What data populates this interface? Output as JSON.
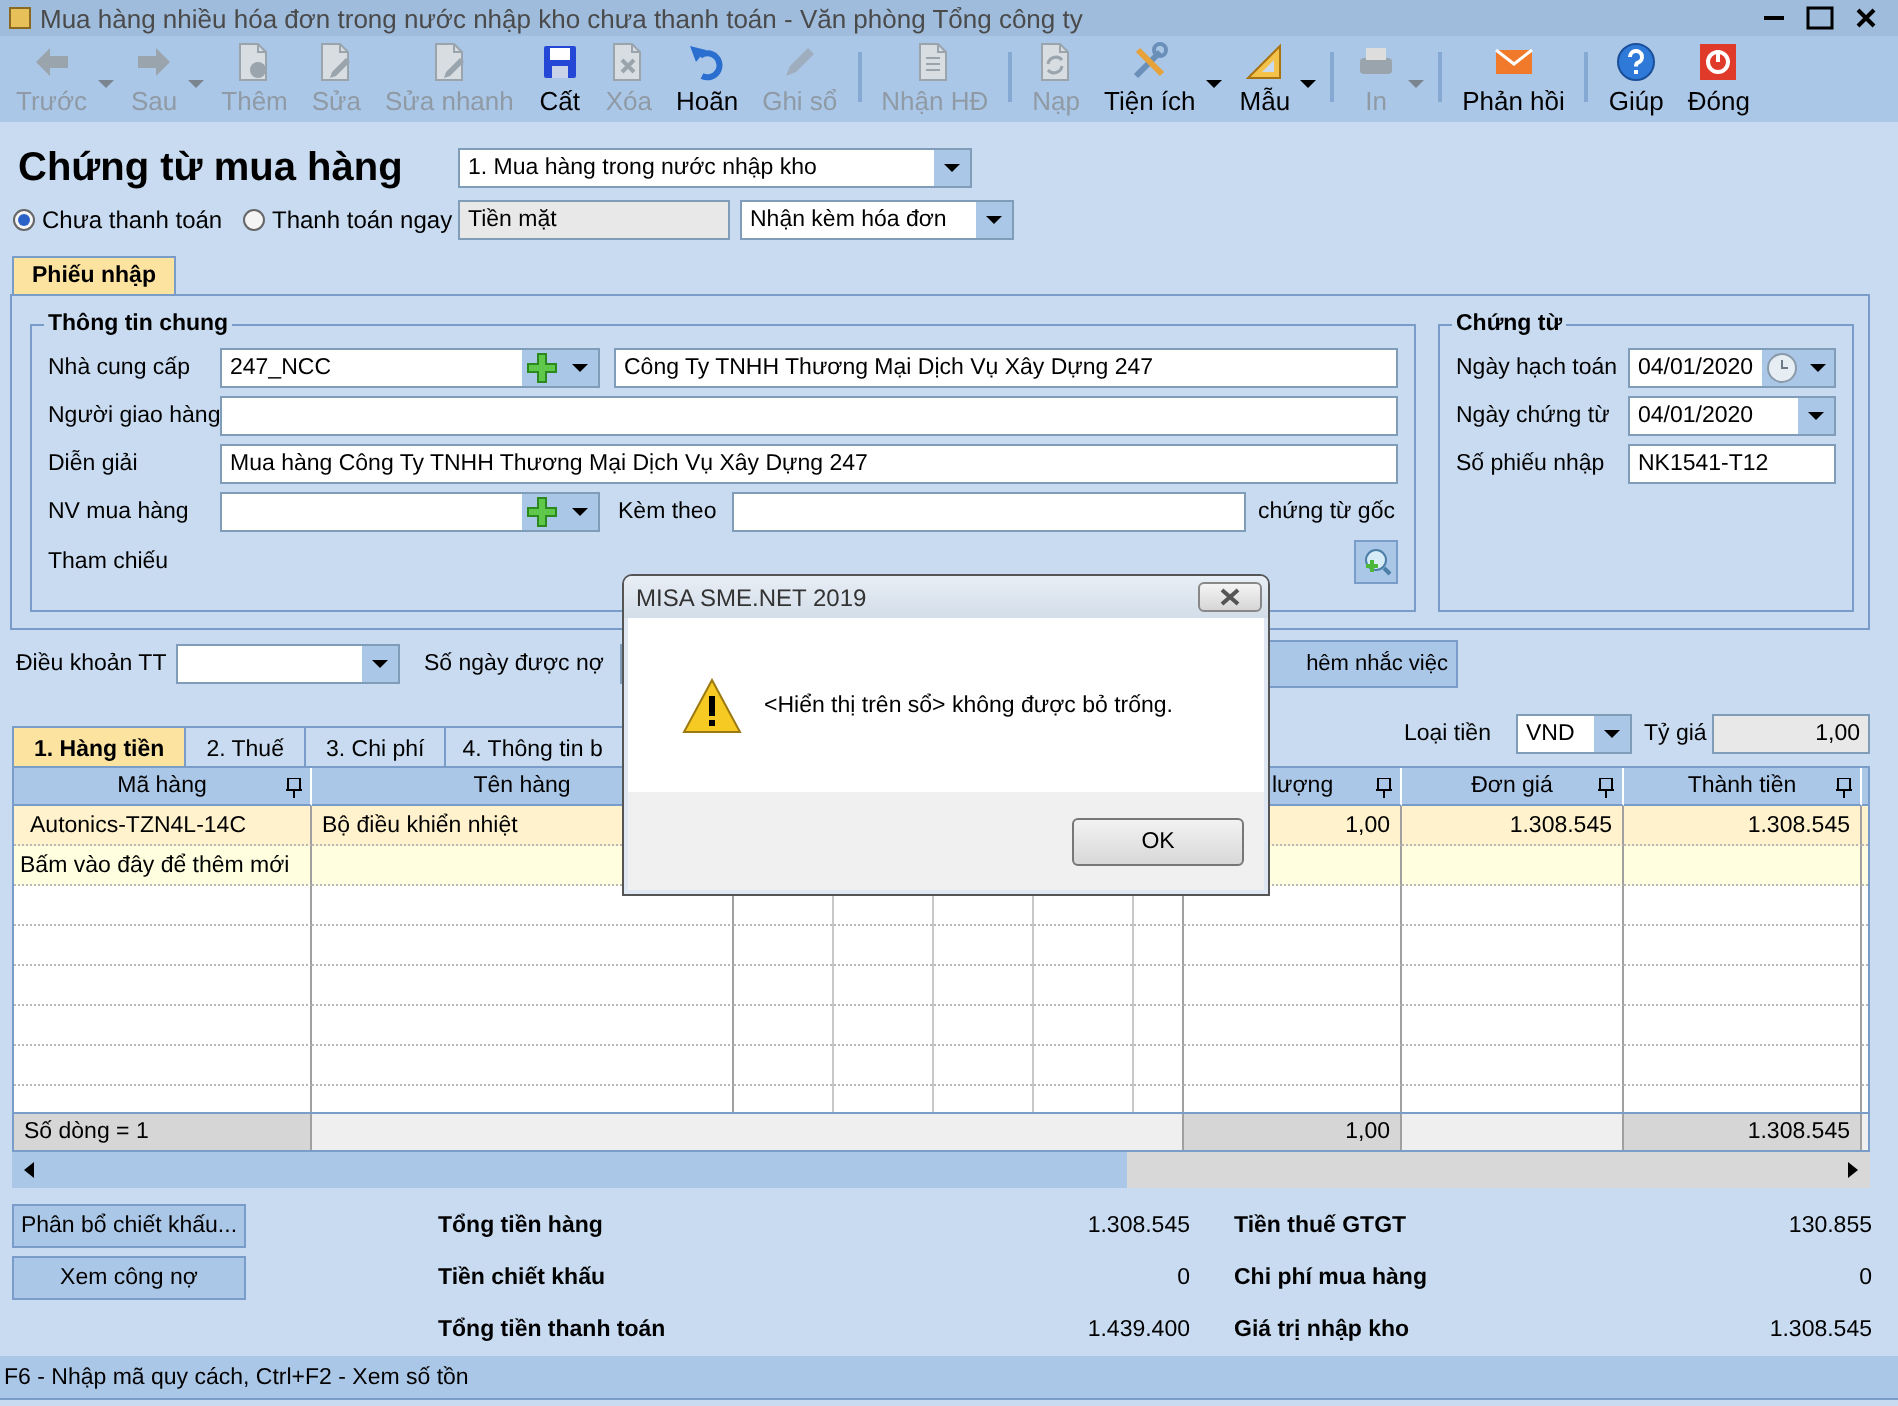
{
  "window": {
    "title": "Mua hàng nhiều hóa đơn trong nước nhập kho chưa thanh toán - Văn phòng Tổng công ty"
  },
  "toolbar": [
    {
      "label": "Trước",
      "kind": "back",
      "disabled": true,
      "dropdown": true,
      "separator_after": false
    },
    {
      "label": "Sau",
      "kind": "forward",
      "disabled": true,
      "dropdown": true,
      "separator_after": false
    },
    {
      "label": "Thêm",
      "kind": "add",
      "disabled": true,
      "dropdown": false,
      "separator_after": false
    },
    {
      "label": "Sửa",
      "kind": "edit",
      "disabled": true,
      "dropdown": false,
      "separator_after": false
    },
    {
      "label": "Sửa nhanh",
      "kind": "edit",
      "disabled": true,
      "dropdown": false,
      "separator_after": false
    },
    {
      "label": "Cất",
      "kind": "save",
      "disabled": false,
      "dropdown": false,
      "separator_after": false
    },
    {
      "label": "Xóa",
      "kind": "delete",
      "disabled": true,
      "dropdown": false,
      "separator_after": false
    },
    {
      "label": "Hoãn",
      "kind": "undo",
      "disabled": false,
      "dropdown": false,
      "separator_after": false
    },
    {
      "label": "Ghi sổ",
      "kind": "post",
      "disabled": true,
      "dropdown": false,
      "separator_after": true
    },
    {
      "label": "Nhận HĐ",
      "kind": "invoice",
      "disabled": true,
      "dropdown": false,
      "separator_after": true
    },
    {
      "label": "Nạp",
      "kind": "reload",
      "disabled": true,
      "dropdown": false,
      "separator_after": false
    },
    {
      "label": "Tiện ích",
      "kind": "tools",
      "disabled": false,
      "dropdown": true,
      "separator_after": false
    },
    {
      "label": "Mẫu",
      "kind": "template",
      "disabled": false,
      "dropdown": true,
      "separator_after": true
    },
    {
      "label": "In",
      "kind": "print",
      "disabled": true,
      "dropdown": true,
      "separator_after": true
    },
    {
      "label": "Phản hồi",
      "kind": "feedback",
      "disabled": false,
      "dropdown": false,
      "separator_after": true
    },
    {
      "label": "Giúp",
      "kind": "help",
      "disabled": false,
      "dropdown": false,
      "separator_after": false
    },
    {
      "label": "Đóng",
      "kind": "close",
      "disabled": false,
      "dropdown": false,
      "separator_after": false
    }
  ],
  "header": {
    "title": "Chứng từ mua hàng",
    "voucher_type": "1. Mua hàng trong nước nhập kho",
    "payment_options": [
      {
        "label": "Chưa thanh toán",
        "selected": true
      },
      {
        "label": "Thanh toán ngay",
        "selected": false
      }
    ],
    "payment_method": "Tiền mặt",
    "invoice_option": "Nhận kèm hóa đơn"
  },
  "form_tab": "Phiếu nhập",
  "general": {
    "title": "Thông tin chung",
    "supplier": {
      "label": "Nhà cung cấp",
      "code": "247_NCC",
      "name": "Công Ty TNHH Thương Mại Dịch Vụ Xây Dựng 247"
    },
    "deliverer": {
      "label": "Người giao hàng"
    },
    "description": {
      "label": "Diễn giải",
      "value": "Mua hàng Công Ty TNHH Thương Mại Dịch Vụ Xây Dựng 247"
    },
    "buyer": {
      "label": "NV mua hàng"
    },
    "attached": {
      "label": "Kèm theo",
      "suffix": "chứng từ gốc"
    },
    "reference": {
      "label": "Tham chiếu"
    }
  },
  "voucher": {
    "title": "Chứng từ",
    "posting_date": {
      "label": "Ngày hạch toán",
      "value": "04/01/2020"
    },
    "voucher_date": {
      "label": "Ngày chứng từ",
      "value": "04/01/2020"
    },
    "number": {
      "label": "Số phiếu nhập",
      "value": "NK1541-T12"
    }
  },
  "terms": {
    "payment_terms_label": "Điều khoản TT",
    "due_days_label": "Số ngày được nợ",
    "reminder_button": "hêm nhắc việc"
  },
  "grid_tabs": [
    {
      "label": "1. Hàng tiền",
      "selected": true
    },
    {
      "label": "2. Thuế",
      "selected": false
    },
    {
      "label": "3. Chi phí",
      "selected": false
    },
    {
      "label": "4. Thông tin b",
      "selected": false
    }
  ],
  "currency": {
    "label": "Loại tiền",
    "value": "VND",
    "rate_label": "Tỷ giá",
    "rate": "1,00"
  },
  "table": {
    "columns": [
      {
        "label": "Mã hàng",
        "pinned": true
      },
      {
        "label": "Tên hàng",
        "pinned": false
      },
      {
        "label": "lượng",
        "pinned": true
      },
      {
        "label": "Đơn giá",
        "pinned": true
      },
      {
        "label": "Thành tiền",
        "pinned": true
      }
    ],
    "rows": [
      {
        "kind": "item",
        "selected": true,
        "cells": [
          "Autonics-TZN4L-14C",
          "Bộ điều khiển nhiệt",
          "1,00",
          "1.308.545",
          "1.308.545"
        ]
      },
      {
        "kind": "new",
        "selected": false,
        "text": "Bấm vào đây để thêm mới"
      }
    ],
    "footer": {
      "row_count": "Số dòng = 1",
      "quantity": "1,00",
      "amount": "1.308.545"
    }
  },
  "actions": [
    "Phân bổ chiết khấu...",
    "Xem công nợ"
  ],
  "totals_left": [
    {
      "label": "Tổng tiền hàng",
      "value": "1.308.545"
    },
    {
      "label": "Tiền chiết khấu",
      "value": "0"
    },
    {
      "label": "Tổng tiền thanh toán",
      "value": "1.439.400"
    }
  ],
  "totals_right": [
    {
      "label": "Tiền thuế GTGT",
      "value": "130.855"
    },
    {
      "label": "Chi phí mua hàng",
      "value": "0"
    },
    {
      "label": "Giá trị nhập kho",
      "value": "1.308.545"
    }
  ],
  "status_bar": "F6 - Nhập mã quy cách, Ctrl+F2 - Xem số tồn",
  "dialog": {
    "title": "MISA SME.NET 2019",
    "message": "<Hiển thị trên sổ> không được bỏ trống.",
    "button": "OK"
  }
}
